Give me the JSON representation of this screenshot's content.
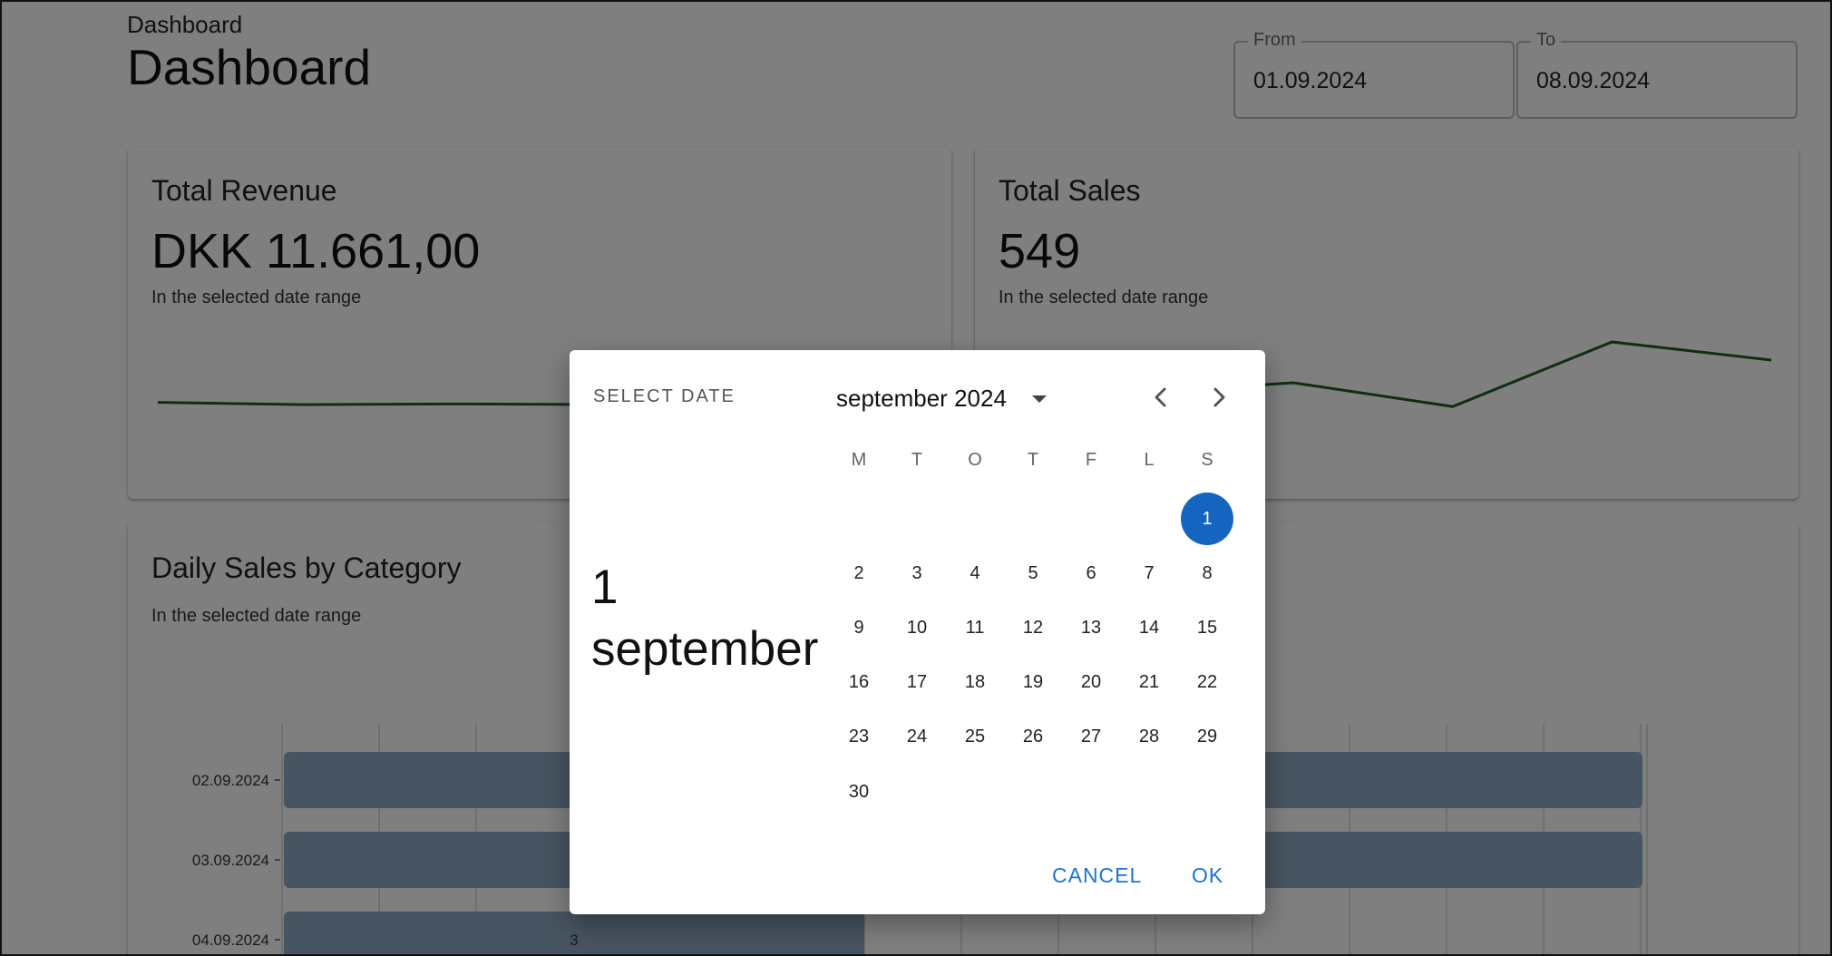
{
  "header": {
    "breadcrumb": "Dashboard",
    "title": "Dashboard",
    "from": {
      "label": "From",
      "value": "01.09.2024"
    },
    "to": {
      "label": "To",
      "value": "08.09.2024"
    }
  },
  "cards": {
    "revenue": {
      "title": "Total Revenue",
      "value": "DKK 11.661,00",
      "subtitle": "In the selected date range"
    },
    "sales": {
      "title": "Total Sales",
      "value": "549",
      "subtitle": "In the selected date range"
    },
    "category": {
      "title": "Daily Sales by Category",
      "subtitle": "In the selected date range"
    }
  },
  "chart_data": [
    {
      "type": "line",
      "series": [
        {
          "values": [
            80,
            66,
            70,
            67
          ]
        }
      ],
      "color": "#1b5e20"
    },
    {
      "type": "line",
      "series": [
        {
          "values": [
            74,
            55,
            64,
            43,
            100,
            84
          ]
        }
      ],
      "color": "#1b5e20"
    },
    {
      "type": "bar",
      "orientation": "horizontal",
      "categories": [
        "02.09.2024",
        "03.09.2024",
        "04.09.2024"
      ],
      "data_labels": [
        "",
        "",
        "3"
      ],
      "color": "#8ea8c3"
    }
  ],
  "dialog": {
    "caption": "SELECT DATE",
    "selected_day": "1",
    "selected_month": "september",
    "month_label": "september 2024",
    "weekdays": [
      "M",
      "T",
      "O",
      "T",
      "F",
      "L",
      "S"
    ],
    "first_weekday_index": 6,
    "days_in_month": 30,
    "selected": 1,
    "selected_color": "#1565c0",
    "cancel": "CANCEL",
    "ok": "OK",
    "icons": {
      "prev": "chevron-left-icon",
      "next": "chevron-right-icon",
      "dropdown": "caret-down-icon"
    }
  },
  "colors": {
    "accent": "#1976d2",
    "line": "#1b5e20"
  }
}
